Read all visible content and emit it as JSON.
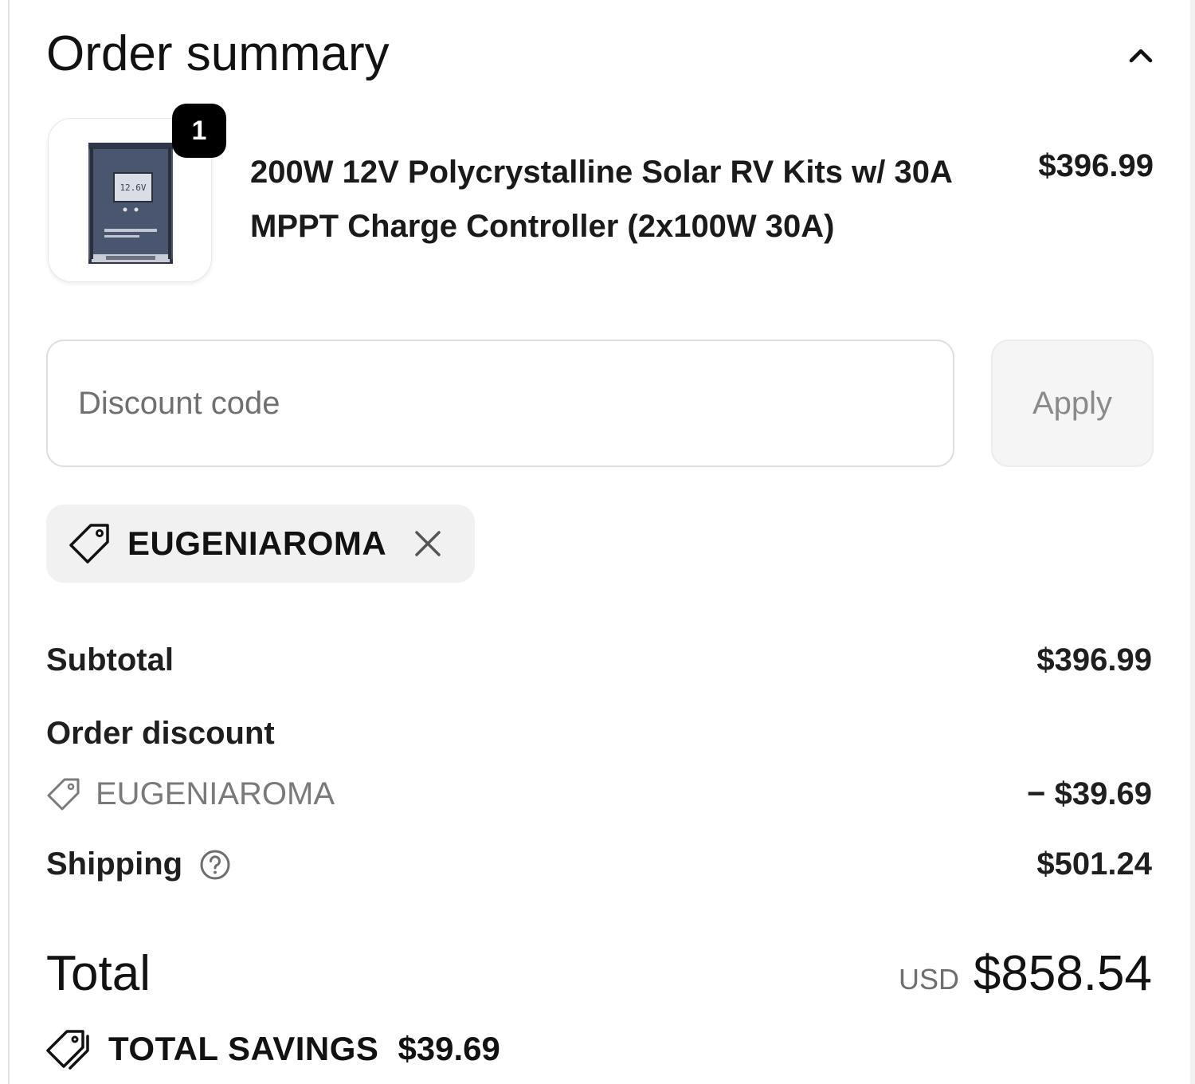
{
  "header": {
    "title": "Order summary",
    "collapse_icon": "chevron-up-icon"
  },
  "line_item": {
    "quantity": "1",
    "name": "200W 12V Polycrystalline Solar RV Kits w/ 30A MPPT Charge Controller (2x100W 30A)",
    "price": "$396.99",
    "image_icon": "charge-controller-thumbnail",
    "screen_text": "12.6V"
  },
  "discount": {
    "placeholder": "Discount code",
    "apply_label": "Apply",
    "applied_code": "EUGENIAROMA"
  },
  "totals": {
    "subtotal_label": "Subtotal",
    "subtotal_value": "$396.99",
    "order_discount_label": "Order discount",
    "discount_code": "EUGENIAROMA",
    "discount_value": "− $39.69",
    "shipping_label": "Shipping",
    "shipping_value": "$501.24",
    "total_label": "Total",
    "currency": "USD",
    "total_value": "$858.54",
    "savings_label": "TOTAL SAVINGS",
    "savings_value": "$39.69"
  },
  "colors": {
    "text": "#121212",
    "muted": "#707070",
    "badge": "#000000",
    "chip_bg": "#f1f1f1"
  }
}
